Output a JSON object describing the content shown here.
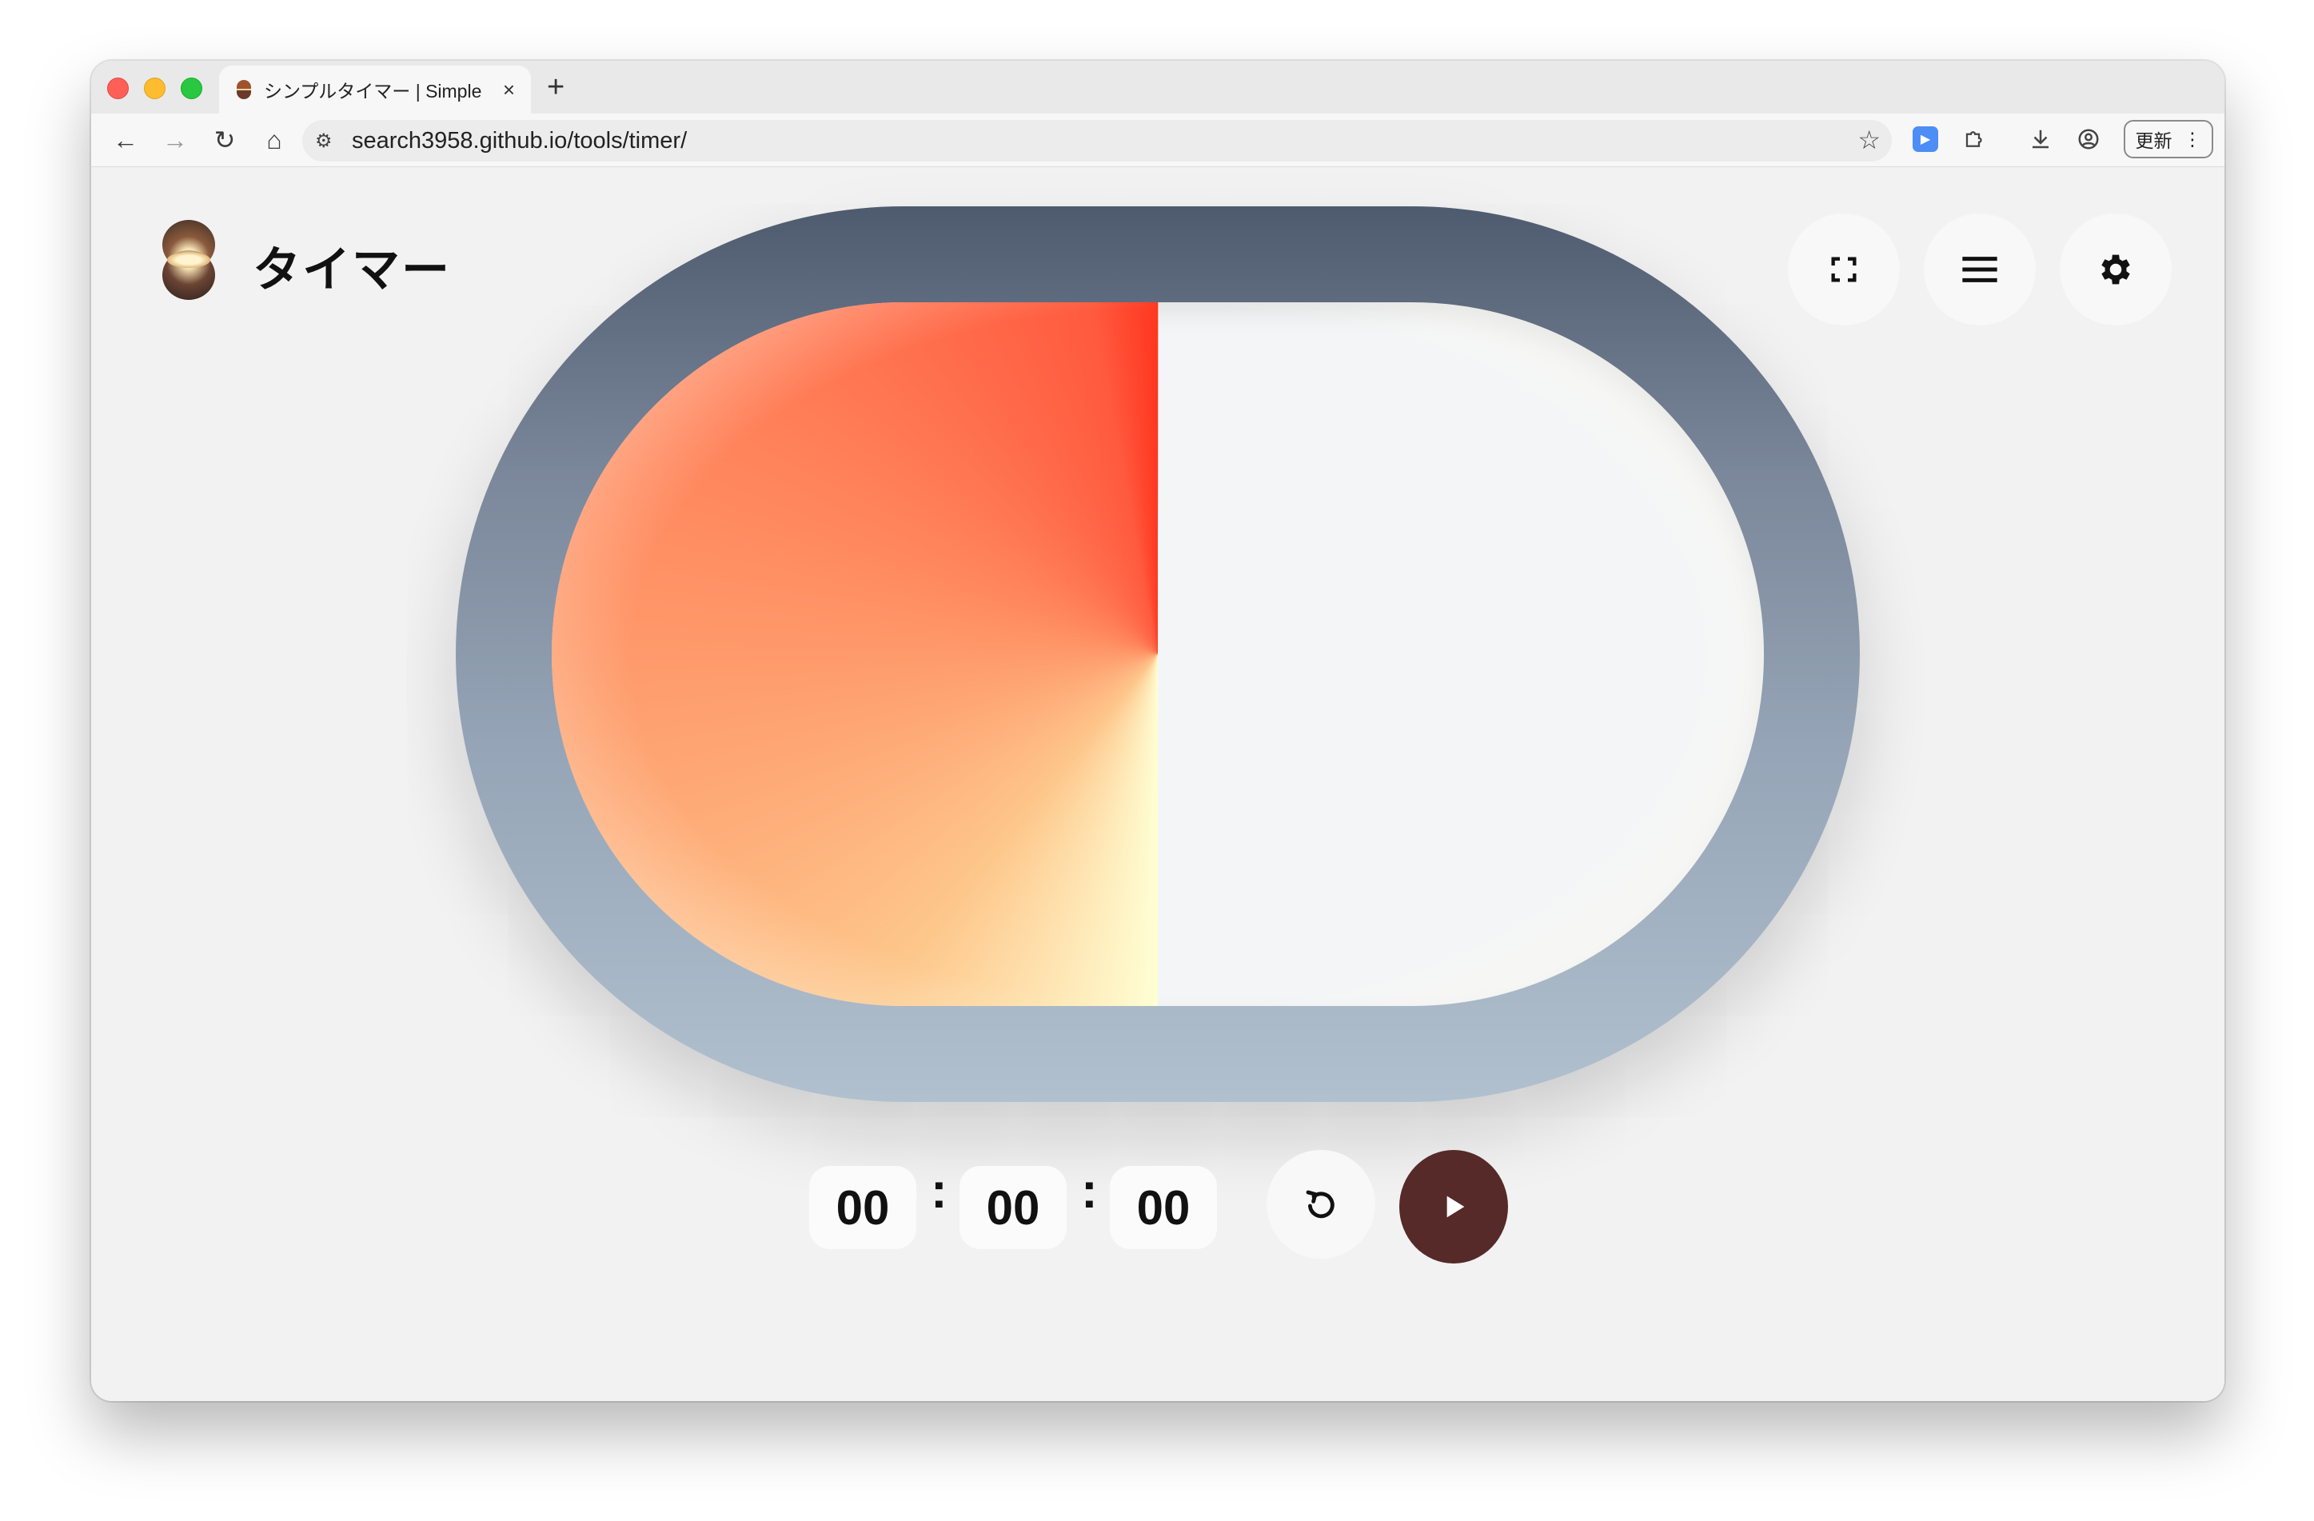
{
  "browser": {
    "tab_title": "シンプルタイマー | Simple",
    "tab_close": "×",
    "new_tab": "+",
    "url": "search3958.github.io/tools/timer/",
    "update_label": "更新",
    "nav": {
      "back": "←",
      "forward": "→",
      "reload": "↻",
      "home": "⌂"
    },
    "more": "⋮"
  },
  "page": {
    "title": "タイマー"
  },
  "timer": {
    "hours": "00",
    "minutes": "00",
    "seconds": "00",
    "separator": ":",
    "remaining_fraction": 0.5
  },
  "icons": {
    "fullscreen": "fullscreen-icon",
    "menu": "menu-icon",
    "settings": "gear-icon",
    "reset": "reset-icon",
    "play": "play-icon"
  },
  "colors": {
    "play_button": "#552a29",
    "progress_hot": "#ff3720",
    "progress_warm": "#ff8a60",
    "frame": "#7b879a"
  }
}
